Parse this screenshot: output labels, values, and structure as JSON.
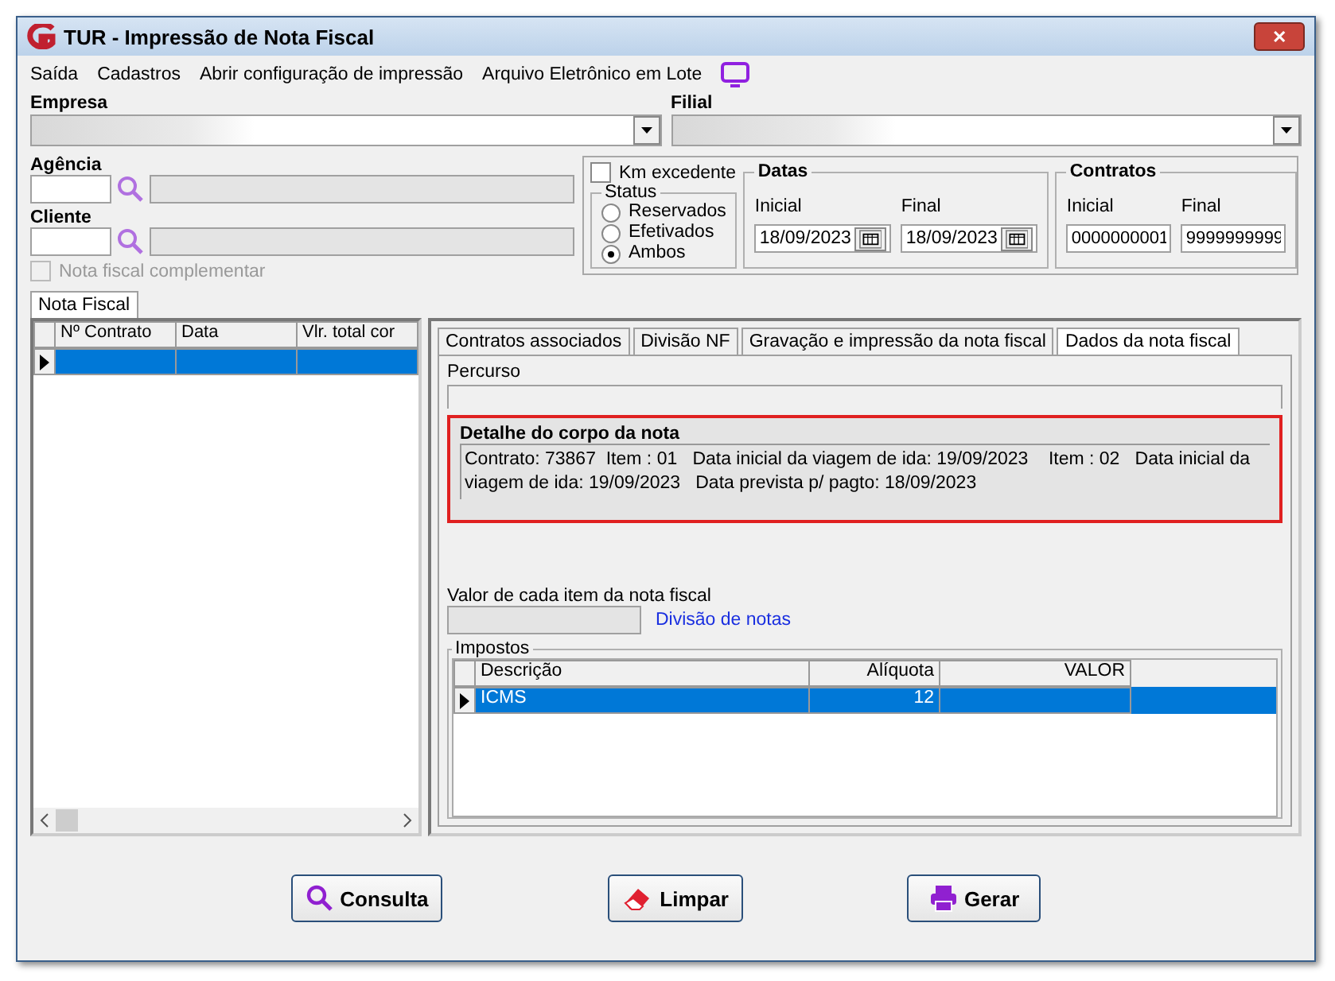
{
  "window": {
    "title": "TUR - Impressão de Nota Fiscal",
    "close": "✕"
  },
  "menu": [
    {
      "label": "Saída"
    },
    {
      "label": "Cadastros"
    },
    {
      "label": "Abrir configuração de impressão"
    },
    {
      "label": "Arquivo Eletrônico em Lote"
    }
  ],
  "empresa": {
    "label": "Empresa"
  },
  "filial": {
    "label": "Filial"
  },
  "agencia": {
    "label": "Agência"
  },
  "cliente": {
    "label": "Cliente"
  },
  "nota_complementar": {
    "label": "Nota fiscal complementar",
    "checked": false,
    "disabled": true
  },
  "km_excedente": {
    "label": "Km excedente",
    "checked": false
  },
  "status": {
    "title": "Status",
    "options": [
      {
        "label": "Reservados",
        "selected": false
      },
      {
        "label": "Efetivados",
        "selected": false
      },
      {
        "label": "Ambos",
        "selected": true
      }
    ]
  },
  "datas": {
    "title": "Datas",
    "inicial": {
      "label": "Inicial",
      "value": "18/09/2023"
    },
    "final": {
      "label": "Final",
      "value": "18/09/2023"
    }
  },
  "contratos": {
    "title": "Contratos",
    "inicial": {
      "label": "Inicial",
      "value": "0000000001"
    },
    "final": {
      "label": "Final",
      "value": "9999999999"
    }
  },
  "left_tabs": [
    {
      "label": "Nota Fiscal",
      "selected": true
    }
  ],
  "contracts_table": {
    "columns": [
      "Nº Contrato",
      "Data",
      "Vlr. total cor"
    ],
    "rows": [
      {
        "selected": true
      }
    ]
  },
  "right_tabs": [
    {
      "label": "Contratos associados",
      "selected": false
    },
    {
      "label": "Divisão NF",
      "selected": false
    },
    {
      "label": "Gravação e impressão da nota fiscal",
      "selected": false
    },
    {
      "label": "Dados da nota fiscal",
      "selected": true
    }
  ],
  "percurso": {
    "label": "Percurso"
  },
  "detalhe": {
    "title": "Detalhe do corpo da nota",
    "text": "Contrato: 73867  Item : 01   Data inicial da viagem de ida: 19/09/2023    Item : 02   Data inicial da viagem de ida: 19/09/2023   Data prevista p/ pagto: 18/09/2023"
  },
  "valor": {
    "label": "Valor de cada item da nota fiscal",
    "link": "Divisão de notas"
  },
  "impostos": {
    "title": "Impostos",
    "columns": [
      "Descrição",
      "Alíquota",
      "VALOR"
    ],
    "rows": [
      {
        "cells": [
          "ICMS",
          "12"
        ],
        "selected": true
      }
    ]
  },
  "buttons": [
    {
      "label": "Consulta",
      "kind": "search"
    },
    {
      "label": "Limpar",
      "kind": "eraser"
    },
    {
      "label": "Gerar",
      "kind": "print"
    }
  ]
}
